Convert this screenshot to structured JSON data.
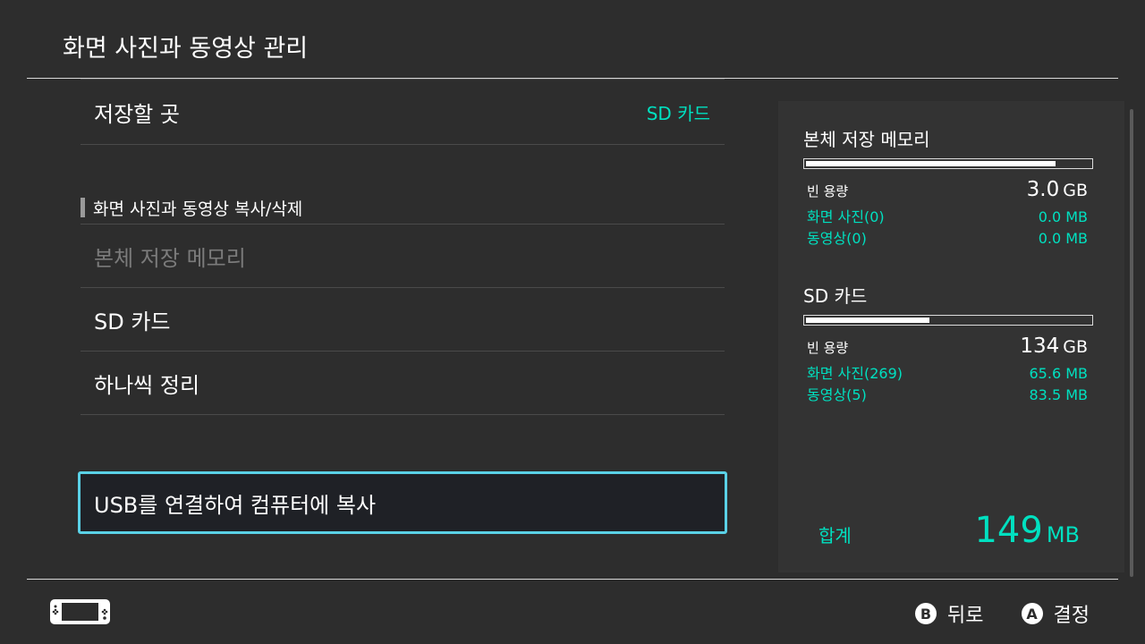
{
  "title": "화면 사진과 동영상 관리",
  "storage_row": {
    "label": "저장할 곳",
    "value": "SD 카드"
  },
  "section_header": "화면 사진과 동영상 복사/삭제",
  "menu": [
    {
      "label": "본체 저장 메모리",
      "enabled": false
    },
    {
      "label": "SD 카드",
      "enabled": true
    },
    {
      "label": "하나씩 정리",
      "enabled": true
    }
  ],
  "usb_copy": "USB를 연결하여 컴퓨터에 복사",
  "panel": {
    "internal": {
      "header": "본체 저장 메모리",
      "used_fraction": 0.88,
      "free_label": "빈 용량",
      "free_value": "3.0",
      "free_unit": "GB",
      "photos_label": "화면 사진(0)",
      "photos_size": "0.0 MB",
      "videos_label": "동영상(0)",
      "videos_size": "0.0 MB"
    },
    "sd": {
      "header": "SD 카드",
      "used_fraction": 0.44,
      "free_label": "빈 용량",
      "free_value": "134",
      "free_unit": "GB",
      "photos_label": "화면 사진(269)",
      "photos_size": "65.6 MB",
      "videos_label": "동영상(5)",
      "videos_size": "83.5 MB"
    },
    "total_label": "합계",
    "total_value": "149",
    "total_unit": "MB"
  },
  "footer": {
    "b_glyph": "B",
    "b_label": "뒤로",
    "a_glyph": "A",
    "a_label": "결정"
  },
  "colors": {
    "accent": "#00e0c0",
    "focus": "#5ad1e6",
    "background": "#2d2d2d"
  }
}
